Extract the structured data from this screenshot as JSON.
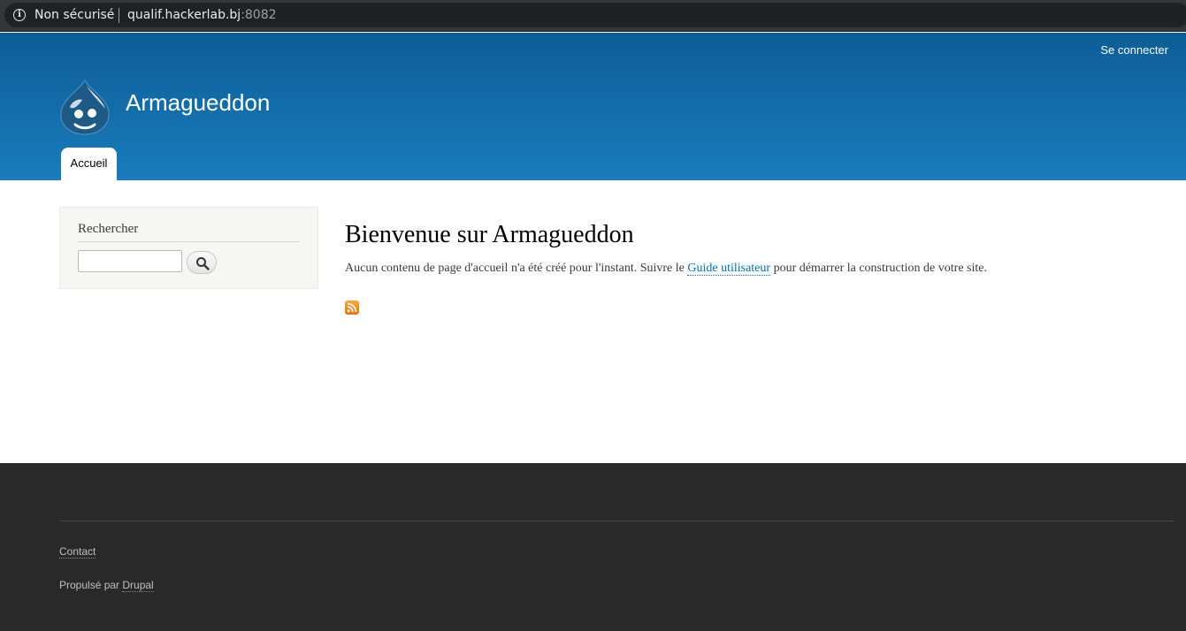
{
  "browser": {
    "security_label": "Non sécurisé",
    "url_host": "qualif.hackerlab.bj",
    "url_port": ":8082"
  },
  "header": {
    "login_label": "Se connecter",
    "site_name": "Armagueddon",
    "tabs": [
      {
        "label": "Accueil"
      }
    ]
  },
  "sidebar": {
    "search_title": "Rechercher",
    "search_value": ""
  },
  "main": {
    "title": "Bienvenue sur Armagueddon",
    "intro_before": "Aucun contenu de page d'accueil n'a été créé pour l'instant. Suivre le ",
    "intro_link": "Guide utilisateur",
    "intro_after": " pour démarrer la construction de votre site."
  },
  "footer": {
    "contact_label": "Contact",
    "powered_prefix": "Propulsé par ",
    "powered_link": "Drupal"
  },
  "colors": {
    "header_top": "#0d5d96",
    "header_bottom": "#1a7cbc",
    "link": "#0071b3",
    "footer_bg": "#292929",
    "feed_orange": "#e2760c"
  },
  "icons": [
    "info-icon",
    "drupal-logo-icon",
    "search-icon",
    "rss-feed-icon"
  ]
}
